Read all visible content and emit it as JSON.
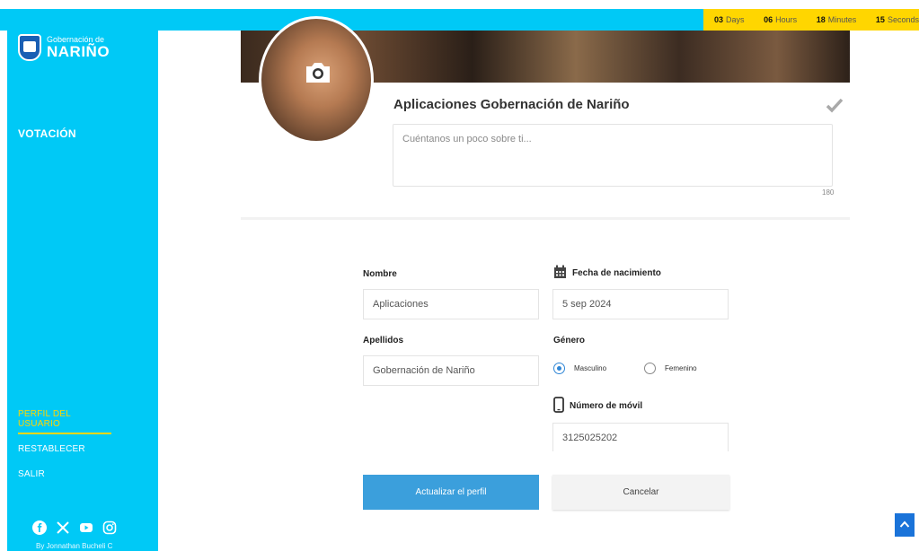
{
  "countdown": {
    "days_value": "03",
    "days_label": "Days",
    "hours_value": "06",
    "hours_label": "Hours",
    "minutes_value": "18",
    "minutes_label": "Minutes",
    "seconds_value": "15",
    "seconds_label": "Seconds"
  },
  "sidebar": {
    "logo_small": "Gobernación de",
    "logo_big": "NARIÑO",
    "main_item": "VOTACIÓN",
    "items": [
      {
        "label": "PERFIL DEL USUARIO"
      },
      {
        "label": "RESTABLECER"
      },
      {
        "label": "SALIR"
      }
    ],
    "credit": "By Jonnathan Bucheli C"
  },
  "profile": {
    "username": "Aplicaciones Gobernación de Nariño",
    "bio_placeholder": "Cuéntanos un poco sobre ti...",
    "bio_counter": "180"
  },
  "form": {
    "nombre_label": "Nombre",
    "nombre_value": "Aplicaciones",
    "apellidos_label": "Apellidos",
    "apellidos_value": "Gobernación de Nariño",
    "fecha_label": "Fecha de nacimiento",
    "fecha_value": "5 sep 2024",
    "genero_label": "Género",
    "genero_options": [
      "Masculino",
      "Femenino"
    ],
    "movil_label": "Número de móvil",
    "movil_value": "3125025202"
  },
  "buttons": {
    "update": "Actualizar el perfil",
    "cancel": "Cancelar"
  },
  "colors": {
    "sidebar": "#00c9f6",
    "countdown": "#ffd600",
    "primary_button": "#3b9fdc"
  },
  "icons": [
    "camera-icon",
    "check-icon",
    "calendar-icon",
    "mobile-phone-icon",
    "facebook-icon",
    "x-icon",
    "youtube-icon",
    "instagram-icon",
    "arrow-up-icon"
  ]
}
